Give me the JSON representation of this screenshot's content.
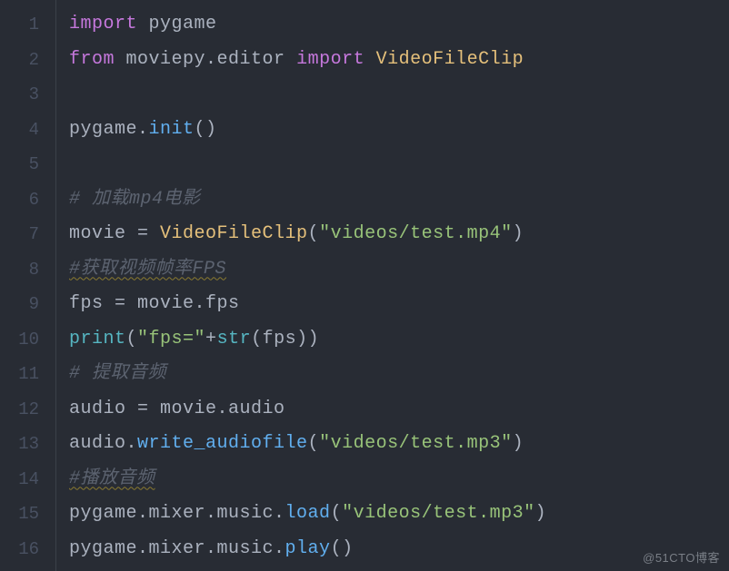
{
  "editor": {
    "watermark": "@51CTO博客",
    "line_numbers": [
      "1",
      "2",
      "3",
      "4",
      "5",
      "6",
      "7",
      "8",
      "9",
      "10",
      "11",
      "12",
      "13",
      "14",
      "15",
      "16"
    ],
    "lines": [
      {
        "tokens": [
          {
            "t": "import",
            "c": "tok-keyword"
          },
          {
            "t": " ",
            "c": "tok-default"
          },
          {
            "t": "pygame",
            "c": "tok-module"
          }
        ]
      },
      {
        "tokens": [
          {
            "t": "from",
            "c": "tok-keyword"
          },
          {
            "t": " ",
            "c": "tok-default"
          },
          {
            "t": "moviepy.editor",
            "c": "tok-module"
          },
          {
            "t": " ",
            "c": "tok-default"
          },
          {
            "t": "import",
            "c": "tok-keyword"
          },
          {
            "t": " ",
            "c": "tok-default"
          },
          {
            "t": "VideoFileClip",
            "c": "tok-class"
          }
        ]
      },
      {
        "tokens": [
          {
            "t": "",
            "c": "tok-default"
          }
        ]
      },
      {
        "tokens": [
          {
            "t": "pygame.",
            "c": "tok-default"
          },
          {
            "t": "init",
            "c": "tok-func"
          },
          {
            "t": "()",
            "c": "tok-punct"
          }
        ]
      },
      {
        "tokens": [
          {
            "t": "",
            "c": "tok-default"
          }
        ]
      },
      {
        "tokens": [
          {
            "t": "# 加载mp4电影",
            "c": "tok-comment"
          }
        ]
      },
      {
        "tokens": [
          {
            "t": "movie = ",
            "c": "tok-default"
          },
          {
            "t": "VideoFileClip",
            "c": "tok-class"
          },
          {
            "t": "(",
            "c": "tok-punct"
          },
          {
            "t": "\"videos/test.mp4\"",
            "c": "tok-string"
          },
          {
            "t": ")",
            "c": "tok-punct"
          }
        ]
      },
      {
        "tokens": [
          {
            "t": "#获取视频帧率FPS",
            "c": "tok-comment squiggle"
          }
        ]
      },
      {
        "tokens": [
          {
            "t": "fps = movie.fps",
            "c": "tok-default"
          }
        ]
      },
      {
        "tokens": [
          {
            "t": "print",
            "c": "tok-builtin"
          },
          {
            "t": "(",
            "c": "tok-punct"
          },
          {
            "t": "\"fps=\"",
            "c": "tok-string"
          },
          {
            "t": "+",
            "c": "tok-op"
          },
          {
            "t": "str",
            "c": "tok-builtin"
          },
          {
            "t": "(fps))",
            "c": "tok-punct"
          }
        ]
      },
      {
        "tokens": [
          {
            "t": "# 提取音频",
            "c": "tok-comment"
          }
        ]
      },
      {
        "tokens": [
          {
            "t": "audio = movie.audio",
            "c": "tok-default"
          }
        ]
      },
      {
        "tokens": [
          {
            "t": "audio.",
            "c": "tok-default"
          },
          {
            "t": "write_audiofile",
            "c": "tok-func"
          },
          {
            "t": "(",
            "c": "tok-punct"
          },
          {
            "t": "\"videos/test.mp3\"",
            "c": "tok-string"
          },
          {
            "t": ")",
            "c": "tok-punct"
          }
        ]
      },
      {
        "tokens": [
          {
            "t": "#播放音频",
            "c": "tok-comment squiggle"
          }
        ]
      },
      {
        "tokens": [
          {
            "t": "pygame.mixer.music.",
            "c": "tok-default"
          },
          {
            "t": "load",
            "c": "tok-func"
          },
          {
            "t": "(",
            "c": "tok-punct"
          },
          {
            "t": "\"videos/test.mp3\"",
            "c": "tok-string"
          },
          {
            "t": ")",
            "c": "tok-punct"
          }
        ]
      },
      {
        "tokens": [
          {
            "t": "pygame.mixer.music.",
            "c": "tok-default"
          },
          {
            "t": "play",
            "c": "tok-func"
          },
          {
            "t": "()",
            "c": "tok-punct"
          }
        ]
      }
    ]
  }
}
